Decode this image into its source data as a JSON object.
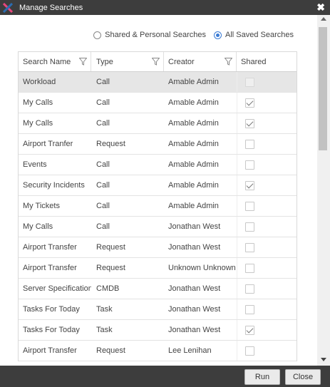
{
  "window": {
    "title": "Manage Searches",
    "close_glyph": "✖"
  },
  "filter_options": {
    "option1_label": "Shared & Personal Searches",
    "option1_selected": false,
    "option2_label": "All Saved Searches",
    "option2_selected": true
  },
  "grid": {
    "columns": {
      "name": "Search Name",
      "type": "Type",
      "creator": "Creator",
      "shared": "Shared"
    },
    "rows": [
      {
        "name": "Workload",
        "type": "Call",
        "creator": "Amable Admin",
        "shared": false,
        "selected": true,
        "disabled": true
      },
      {
        "name": "My Calls",
        "type": "Call",
        "creator": "Amable Admin",
        "shared": true
      },
      {
        "name": "My Calls",
        "type": "Call",
        "creator": "Amable Admin",
        "shared": true
      },
      {
        "name": "Airport Tranfer",
        "type": "Request",
        "creator": "Amable Admin",
        "shared": false
      },
      {
        "name": "Events",
        "type": "Call",
        "creator": "Amable Admin",
        "shared": false
      },
      {
        "name": "Security Incidents",
        "type": "Call",
        "creator": "Amable Admin",
        "shared": true
      },
      {
        "name": "My Tickets",
        "type": "Call",
        "creator": "Amable Admin",
        "shared": false
      },
      {
        "name": "My Calls",
        "type": "Call",
        "creator": "Jonathan West",
        "shared": false
      },
      {
        "name": "Airport Transfer",
        "type": "Request",
        "creator": "Jonathan West",
        "shared": false
      },
      {
        "name": "Airport Transfer",
        "type": "Request",
        "creator": "Unknown Unknown",
        "shared": false
      },
      {
        "name": "Server Specification",
        "type": "CMDB",
        "creator": "Jonathan West",
        "shared": false
      },
      {
        "name": "Tasks For Today",
        "type": "Task",
        "creator": "Jonathan West",
        "shared": false
      },
      {
        "name": "Tasks For Today",
        "type": "Task",
        "creator": "Jonathan West",
        "shared": true
      },
      {
        "name": "Airport Transfer",
        "type": "Request",
        "creator": "Lee Lenihan",
        "shared": false
      }
    ]
  },
  "footer": {
    "run_label": "Run",
    "close_label": "Close"
  },
  "colors": {
    "titlebar": "#3d3d3d",
    "selected_row": "#e6e6e6",
    "radio_accent": "#3a7bd5",
    "logo_pink": "#e8467c",
    "logo_blue": "#2b6cb0"
  },
  "icons": {
    "app": "app-logo-icon",
    "close": "close-icon",
    "filter": "filter-icon",
    "scroll_up": "scroll-up-arrow-icon",
    "scroll_down": "scroll-down-arrow-icon"
  }
}
